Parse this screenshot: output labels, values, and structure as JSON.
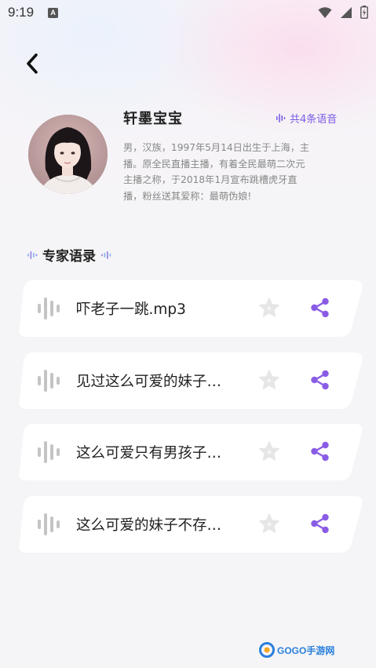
{
  "status_bar": {
    "time": "9:19",
    "notification_letter": "A"
  },
  "profile": {
    "name": "轩墨宝宝",
    "voice_count": "共4条语音",
    "description": "男，汉族，1997年5月14日出生于上海，主播。原全民直播主播，有着全民最萌二次元主播之称，于2018年1月宣布跳槽虎牙直播，粉丝送其爱称：最萌伪娘!"
  },
  "section": {
    "title": "专家语录"
  },
  "voices": [
    {
      "title": "吓老子一跳.mp3"
    },
    {
      "title": "见过这么可爱的妹子…"
    },
    {
      "title": "这么可爱只有男孩子…"
    },
    {
      "title": "这么可爱的妹子不存…"
    }
  ],
  "watermark": {
    "text": "GOGO手游网"
  },
  "colors": {
    "accent": "#7c5ce6",
    "share_icon": "#8a5ce6",
    "wave_gray": "#c4c4c4",
    "star_gray": "#e6e6e6"
  }
}
